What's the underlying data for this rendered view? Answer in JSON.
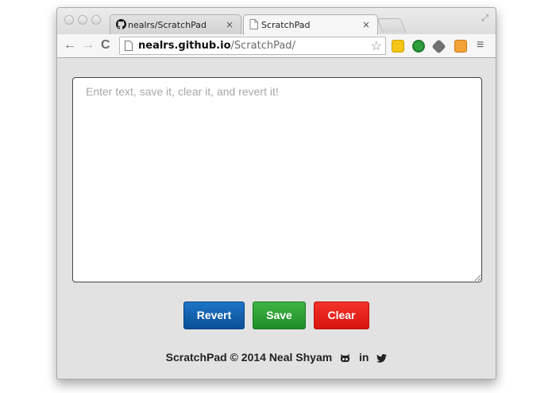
{
  "browser": {
    "tabs": [
      {
        "title": "nealrs/ScratchPad",
        "icon": "github-icon",
        "close": "×"
      },
      {
        "title": "ScratchPad",
        "icon": "page-icon",
        "close": "×"
      }
    ],
    "address": {
      "host": "nealrs.github.io",
      "path": "/ScratchPad/"
    }
  },
  "page": {
    "textarea": {
      "placeholder": "Enter text, save it, clear it, and revert it!",
      "value": ""
    },
    "buttons": {
      "revert": "Revert",
      "save": "Save",
      "clear": "Clear"
    },
    "footer": {
      "text": "ScratchPad © 2014 Neal Shyam",
      "linkedin": "in",
      "icons": [
        "github-octocat-icon",
        "linkedin-icon",
        "twitter-icon"
      ]
    },
    "colors": {
      "revert": "#0b5ca8",
      "save": "#2ea036",
      "clear": "#e8231c"
    }
  }
}
